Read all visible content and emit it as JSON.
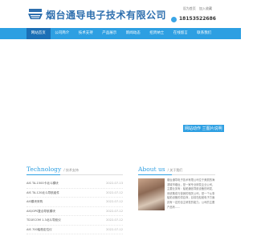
{
  "header": {
    "company_name": "烟台通导电子技术有限公司",
    "top_links": [
      "设为首页",
      "加入收藏"
    ],
    "phone": "18153522686"
  },
  "nav": {
    "items": [
      "网站首页",
      "公司简介",
      "技术支持",
      "产品展示",
      "新闻动态",
      "招贤纳士",
      "在线留言",
      "联系我们"
    ]
  },
  "banner": {
    "caption": "网站动作 兰图片说明"
  },
  "tech": {
    "title_en_first": "T",
    "title_en_rest": "echnology",
    "title_zh": "/ 技术支持",
    "items": [
      {
        "title": "AIS TA-1500卡北斗模块",
        "date": "2022-07-13"
      },
      {
        "title": "AIS TA-120北斗导航组件",
        "date": "2022-07-12"
      },
      {
        "title": "AIS模块采购",
        "date": "2022-07-12"
      },
      {
        "title": "AIS/GPS复合导航模块",
        "date": "2022-07-12"
      },
      {
        "title": "TD1ECOM 1.3北斗导航仪",
        "date": "2022-07-12"
      },
      {
        "title": "AIS 700船舶定位仪",
        "date": "2022-07-12"
      }
    ]
  },
  "about": {
    "title_en": "About us",
    "title_zh": "/ 关于我们",
    "text": "烟台通导电子技术有限公司位于美丽的海滨城市烟台，是一家专业研发企业公司，主要业务有：船舶通信导航设备的研发，系统集成与营销的相关公司，是一个从事船舶设备的供应商，目前在船舶电子方面具有一定的自主研发的能力。公司的主要产品有……"
  }
}
